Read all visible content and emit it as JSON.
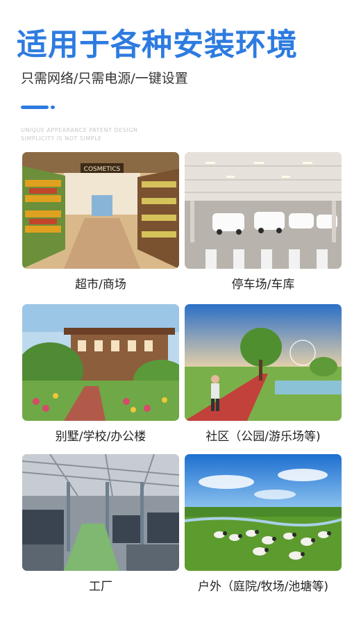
{
  "header": {
    "title": "适用于各种安装环境",
    "subtitle": "只需网络/只需电源/一键设置",
    "ghost_line1": "UNIQUE APPEARANCE PATENT DESIGN",
    "ghost_line2": "SIMPLICITY IS NOT SIMPLE"
  },
  "scenes": [
    {
      "caption": "超市/商场",
      "sign": "COSMETICS"
    },
    {
      "caption": "停车场/车库"
    },
    {
      "caption": "别墅/学校/办公楼"
    },
    {
      "caption": "社区（公园/游乐场等)"
    },
    {
      "caption": "工厂"
    },
    {
      "caption": "户外（庭院/牧场/池塘等)"
    }
  ],
  "colors": {
    "accent": "#2d7be0"
  }
}
